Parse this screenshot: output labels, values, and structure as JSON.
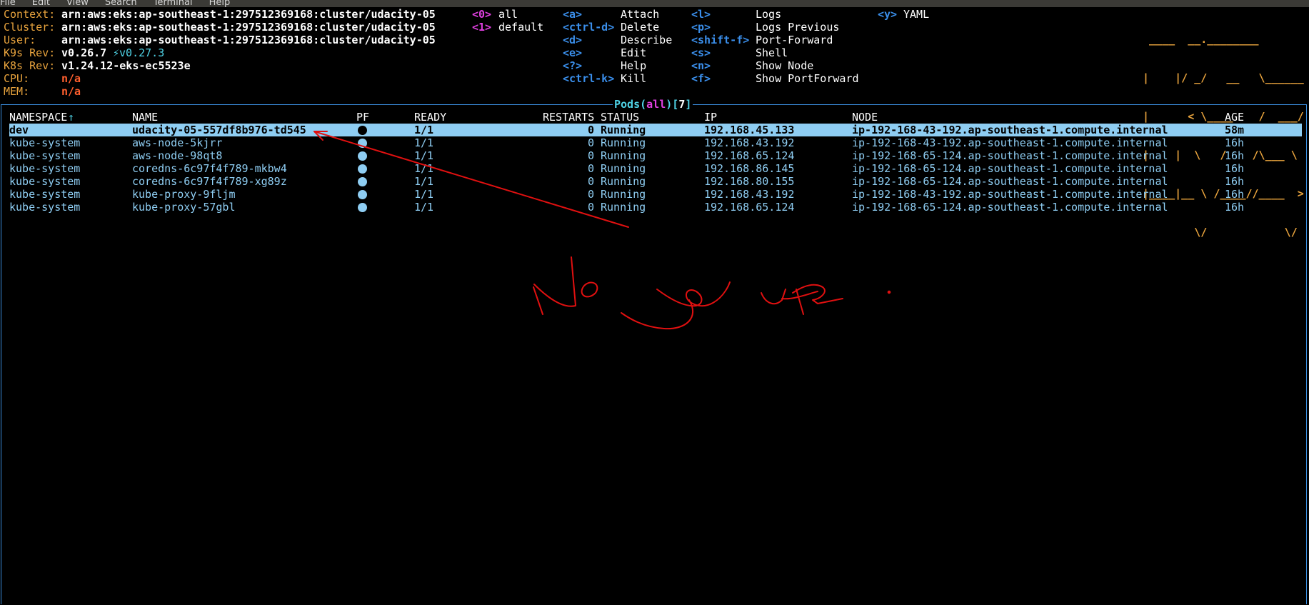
{
  "menubar": [
    "File",
    "Edit",
    "View",
    "Search",
    "Terminal",
    "Help"
  ],
  "header": {
    "context_label": "Context:",
    "context": "arn:aws:eks:ap-southeast-1:297512369168:cluster/udacity-05",
    "cluster_label": "Cluster:",
    "cluster": "arn:aws:eks:ap-southeast-1:297512369168:cluster/udacity-05",
    "user_label": "User:",
    "user": "arn:aws:eks:ap-southeast-1:297512369168:cluster/udacity-05",
    "k9s_label": "K9s Rev:",
    "k9s": "v0.26.7",
    "k9s_upgrade": "⚡v0.27.3",
    "k8s_label": "K8s Rev:",
    "k8s": "v1.24.12-eks-ec5523e",
    "cpu_label": "CPU:",
    "cpu": "n/a",
    "mem_label": "MEM:",
    "mem": "n/a"
  },
  "namespaces": [
    {
      "key": "<0>",
      "name": "all"
    },
    {
      "key": "<1>",
      "name": "default"
    }
  ],
  "shortcuts_col1": [
    {
      "key": "<a>",
      "action": "Attach"
    },
    {
      "key": "<ctrl-d>",
      "action": "Delete"
    },
    {
      "key": "<d>",
      "action": "Describe"
    },
    {
      "key": "<e>",
      "action": "Edit"
    },
    {
      "key": "<?>",
      "action": "Help"
    },
    {
      "key": "<ctrl-k>",
      "action": "Kill"
    }
  ],
  "shortcuts_col2": [
    {
      "key": "<l>",
      "action": "Logs"
    },
    {
      "key": "<p>",
      "action": "Logs Previous"
    },
    {
      "key": "<shift-f>",
      "action": "Port-Forward"
    },
    {
      "key": "<s>",
      "action": "Shell"
    },
    {
      "key": "<n>",
      "action": "Show Node"
    },
    {
      "key": "<f>",
      "action": "Show PortForward"
    }
  ],
  "shortcuts_col3": [
    {
      "key": "<y>",
      "action": "YAML"
    }
  ],
  "logo": [
    " ____  __.________       ",
    "|    |/ _/   __   \\______",
    "|      < \\____    /  ___/",
    "|    |  \\   /    /\\___ \\ ",
    "|____|__ \\ /____//____  >",
    "        \\/            \\/ "
  ],
  "pods": {
    "title_prefix": "Pods(",
    "scope": "all",
    "title_mid": ")[",
    "count": "7",
    "title_suffix": "]",
    "columns": {
      "namespace": "NAMESPACE",
      "sort_indicator": "↑",
      "name": "NAME",
      "pf": "PF",
      "ready": "READY",
      "restarts": "RESTARTS",
      "status": "STATUS",
      "ip": "IP",
      "node": "NODE",
      "age": "AGE"
    },
    "rows": [
      {
        "namespace": "dev",
        "name": "udacity-05-557df8b976-td545",
        "ready": "1/1",
        "restarts": "0",
        "status": "Running",
        "ip": "192.168.45.133",
        "node": "ip-192-168-43-192.ap-southeast-1.compute.internal",
        "age": "58m"
      },
      {
        "namespace": "kube-system",
        "name": "aws-node-5kjrr",
        "ready": "1/1",
        "restarts": "0",
        "status": "Running",
        "ip": "192.168.43.192",
        "node": "ip-192-168-43-192.ap-southeast-1.compute.internal",
        "age": "16h"
      },
      {
        "namespace": "kube-system",
        "name": "aws-node-98qt8",
        "ready": "1/1",
        "restarts": "0",
        "status": "Running",
        "ip": "192.168.65.124",
        "node": "ip-192-168-65-124.ap-southeast-1.compute.internal",
        "age": "16h"
      },
      {
        "namespace": "kube-system",
        "name": "coredns-6c97f4f789-mkbw4",
        "ready": "1/1",
        "restarts": "0",
        "status": "Running",
        "ip": "192.168.86.145",
        "node": "ip-192-168-65-124.ap-southeast-1.compute.internal",
        "age": "16h"
      },
      {
        "namespace": "kube-system",
        "name": "coredns-6c97f4f789-xg89z",
        "ready": "1/1",
        "restarts": "0",
        "status": "Running",
        "ip": "192.168.80.155",
        "node": "ip-192-168-65-124.ap-southeast-1.compute.internal",
        "age": "16h"
      },
      {
        "namespace": "kube-system",
        "name": "kube-proxy-9fljm",
        "ready": "1/1",
        "restarts": "0",
        "status": "Running",
        "ip": "192.168.43.192",
        "node": "ip-192-168-43-192.ap-southeast-1.compute.internal",
        "age": "16h"
      },
      {
        "namespace": "kube-system",
        "name": "kube-proxy-57gbl",
        "ready": "1/1",
        "restarts": "0",
        "status": "Running",
        "ip": "192.168.65.124",
        "node": "ip-192-168-65-124.ap-southeast-1.compute.internal",
        "age": "16h"
      }
    ]
  },
  "annotation": {
    "handwritten_text": "No ya ur.",
    "color": "#e01010"
  },
  "colors": {
    "label": "#e8a33d",
    "key": "#3a8eea",
    "row": "#8ecdf2",
    "border": "#3b8fe0"
  }
}
